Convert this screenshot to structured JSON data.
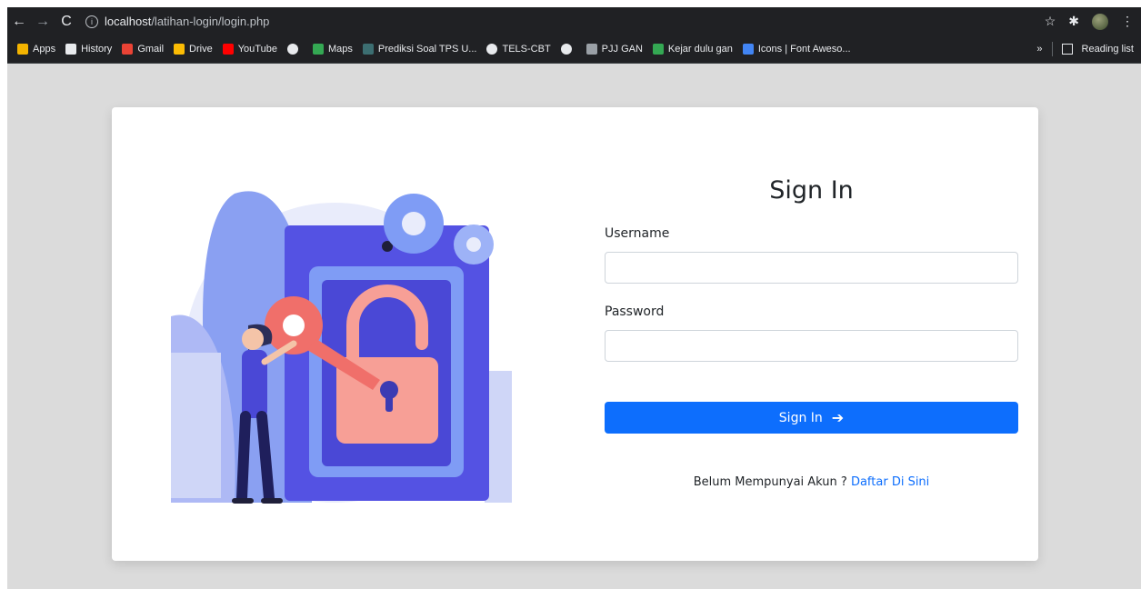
{
  "browser": {
    "url_host": "localhost",
    "url_path": "/latihan-login/login.php",
    "reading_list": "Reading list",
    "overflow": "»"
  },
  "bookmarks": [
    {
      "label": "Apps",
      "icon": "apps-grid-icon",
      "color": "#f4b400"
    },
    {
      "label": "History",
      "icon": "history-icon",
      "color": "#e8eaed"
    },
    {
      "label": "Gmail",
      "icon": "gmail-icon",
      "color": "#ea4335"
    },
    {
      "label": "Drive",
      "icon": "drive-icon",
      "color": "#fbbc04"
    },
    {
      "label": "YouTube",
      "icon": "youtube-icon",
      "color": "#ff0000"
    },
    {
      "label": "",
      "icon": "globe-icon",
      "color": "#e8eaed"
    },
    {
      "label": "Maps",
      "icon": "maps-icon",
      "color": "#34a853"
    },
    {
      "label": "Prediksi Soal TPS U...",
      "icon": "site-icon",
      "color": "#3c6e71"
    },
    {
      "label": "TELS-CBT",
      "icon": "globe-icon",
      "color": "#e8eaed"
    },
    {
      "label": "",
      "icon": "globe-icon",
      "color": "#e8eaed"
    },
    {
      "label": "PJJ GAN",
      "icon": "doc-icon",
      "color": "#9aa0a6"
    },
    {
      "label": "Kejar dulu gan",
      "icon": "site-icon",
      "color": "#34a853"
    },
    {
      "label": "Icons | Font Aweso...",
      "icon": "flag-icon",
      "color": "#4285f4"
    }
  ],
  "form": {
    "title": "Sign In",
    "username_label": "Username",
    "username_value": "",
    "password_label": "Password",
    "password_value": "",
    "submit_label": "Sign In",
    "footer_text": "Belum Mempunyai Akun ?",
    "footer_link": "Daftar Di Sini"
  },
  "colors": {
    "primary": "#0d6efd",
    "page_bg": "#dbdbdb",
    "illustration_blue": "#4f4de0",
    "illustration_pink": "#f79f96"
  }
}
